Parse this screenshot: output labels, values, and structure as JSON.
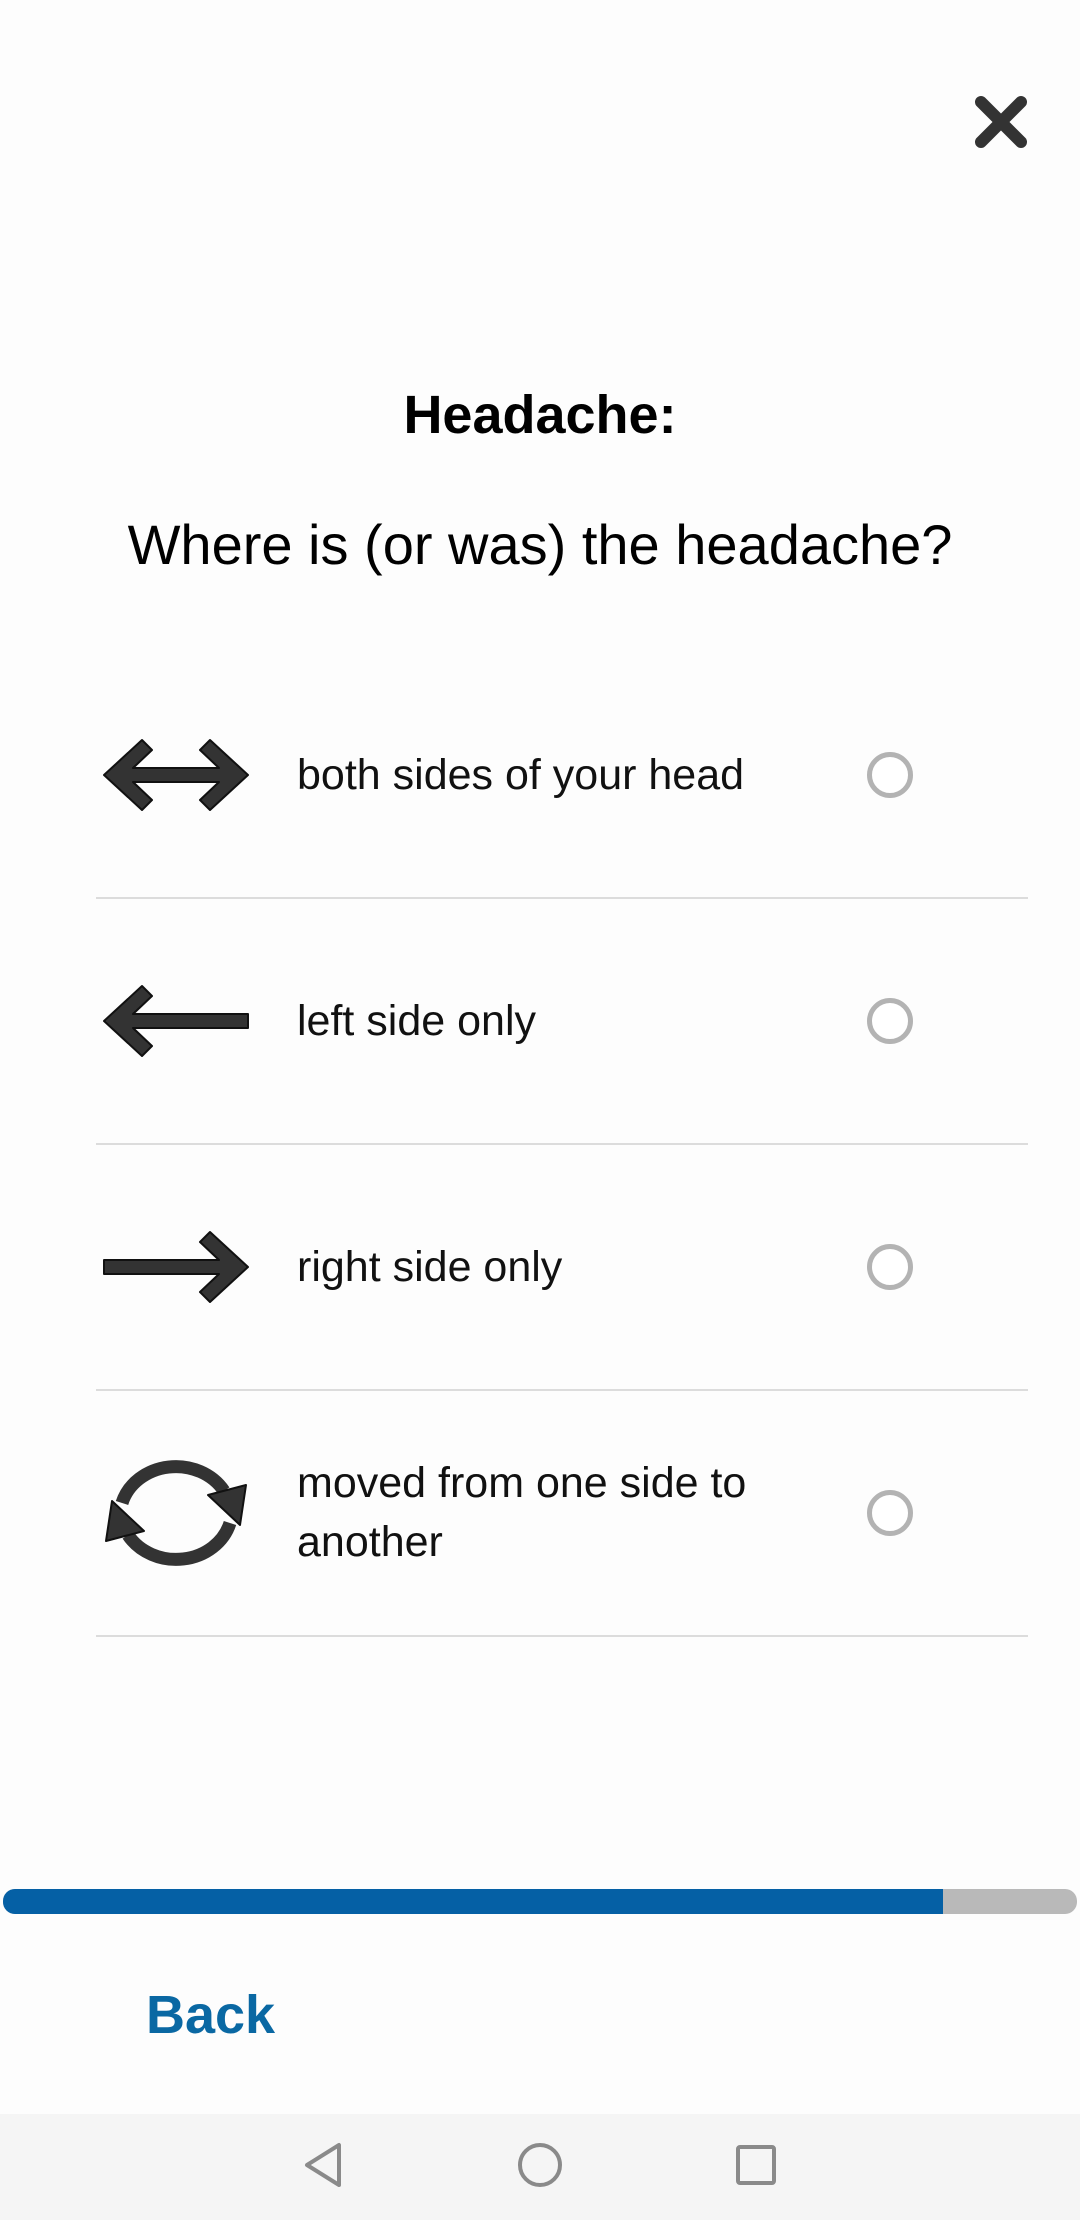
{
  "screen": {
    "title": "Headache:",
    "question": "Where is (or was) the headache?"
  },
  "options": [
    {
      "label": "both sides of your head",
      "icon": "double-arrow-icon",
      "selected": false
    },
    {
      "label": "left side only",
      "icon": "arrow-left-icon",
      "selected": false
    },
    {
      "label": "right side only",
      "icon": "arrow-right-icon",
      "selected": false
    },
    {
      "label": "moved from one side to another",
      "icon": "refresh-cycle-icon",
      "selected": false
    }
  ],
  "progress": {
    "fraction": 0.875
  },
  "footer": {
    "back_label": "Back"
  },
  "colors": {
    "accent": "#0560a5",
    "back_link": "#0a68a3",
    "icon": "#333333",
    "radio_border": "#b3b3b3"
  },
  "system_nav": {
    "icons": [
      "back-triangle-icon",
      "home-circle-icon",
      "recents-square-icon"
    ]
  }
}
